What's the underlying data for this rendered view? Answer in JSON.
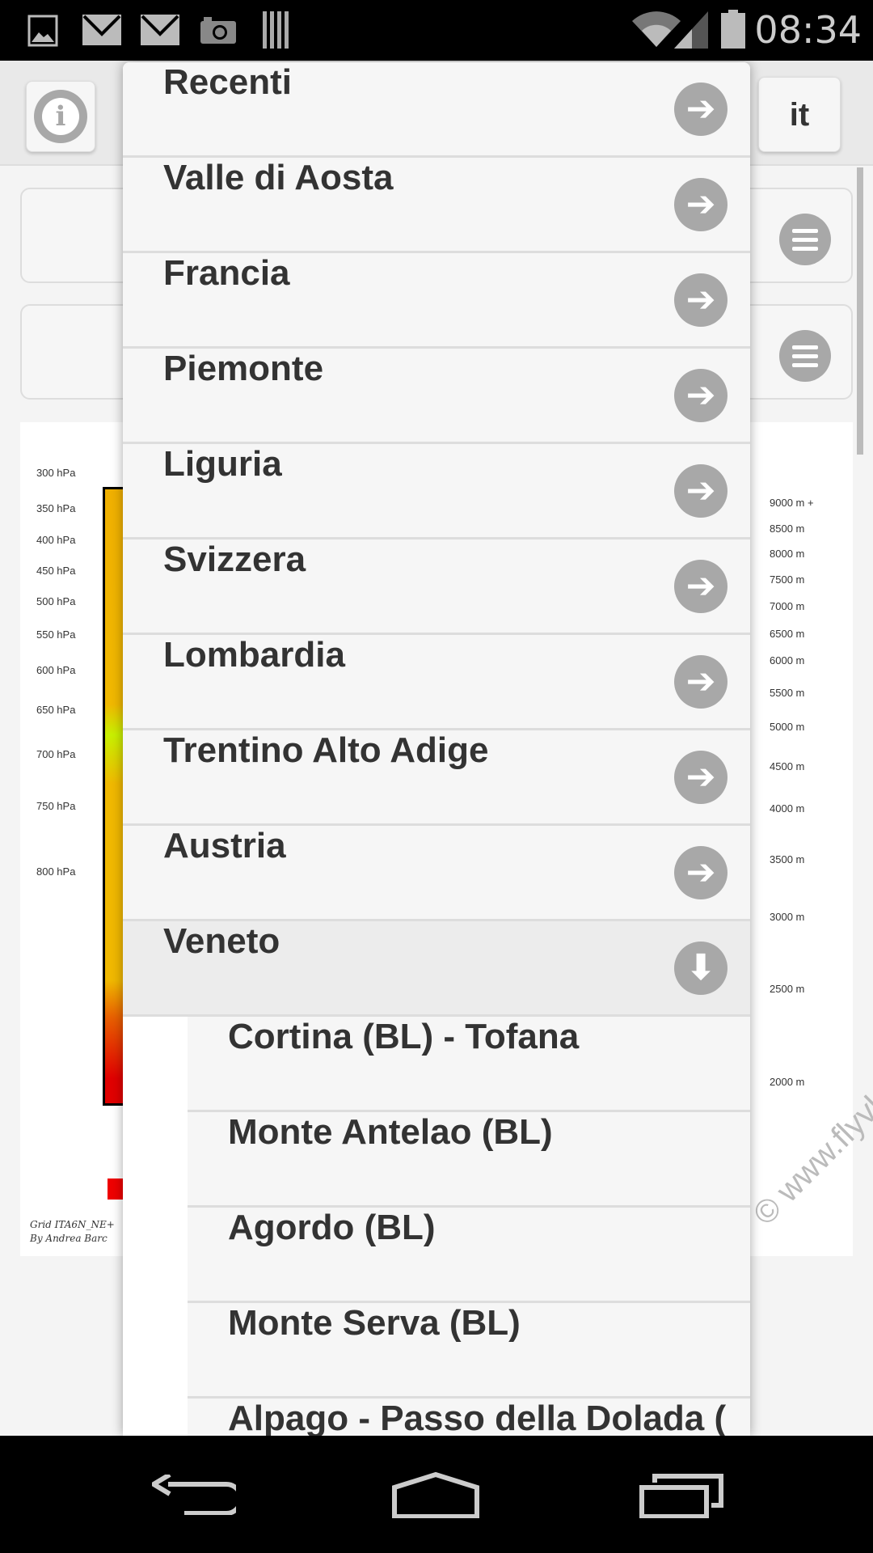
{
  "status_bar": {
    "time": "08:34",
    "icons": [
      "image-icon",
      "mail-icon",
      "mail-icon",
      "camera-icon",
      "barcode-icon",
      "wifi-icon",
      "signal-icon",
      "battery-icon"
    ]
  },
  "header": {
    "info_icon": "i",
    "language": "it"
  },
  "menu": {
    "items": [
      {
        "label": "Recenti",
        "icon": "arrow-right-icon"
      },
      {
        "label": "Valle di Aosta",
        "icon": "arrow-right-icon"
      },
      {
        "label": "Francia",
        "icon": "arrow-right-icon"
      },
      {
        "label": "Piemonte",
        "icon": "arrow-right-icon"
      },
      {
        "label": "Liguria",
        "icon": "arrow-right-icon"
      },
      {
        "label": "Svizzera",
        "icon": "arrow-right-icon"
      },
      {
        "label": "Lombardia",
        "icon": "arrow-right-icon"
      },
      {
        "label": "Trentino Alto Adige",
        "icon": "arrow-right-icon"
      },
      {
        "label": "Austria",
        "icon": "arrow-right-icon"
      },
      {
        "label": "Veneto",
        "icon": "arrow-down-icon",
        "expanded": true
      }
    ],
    "subitems": [
      "Cortina (BL) - Tofana",
      "Monte Antelao (BL)",
      "Agordo (BL)",
      "Monte Serva (BL)",
      "Alpago - Passo della Dolada ("
    ]
  },
  "background_chart": {
    "pressure_labels": [
      "300 hPa",
      "350 hPa",
      "400 hPa",
      "450 hPa",
      "500 hPa",
      "550 hPa",
      "600 hPa",
      "650 hPa",
      "700 hPa",
      "750 hPa",
      "800 hPa"
    ],
    "altitude_labels": [
      "9000 m +",
      "8500 m",
      "8000 m",
      "7500 m",
      "7000 m",
      "6500 m",
      "6000 m",
      "5500 m",
      "5000 m",
      "4500 m",
      "4000 m",
      "3500 m",
      "3000 m",
      "2500 m",
      "2000 m"
    ],
    "watermark": "© www.flyvl.it",
    "footer_lines": [
      "Grid ITA6N_NE+",
      "By Andrea Barc"
    ]
  }
}
